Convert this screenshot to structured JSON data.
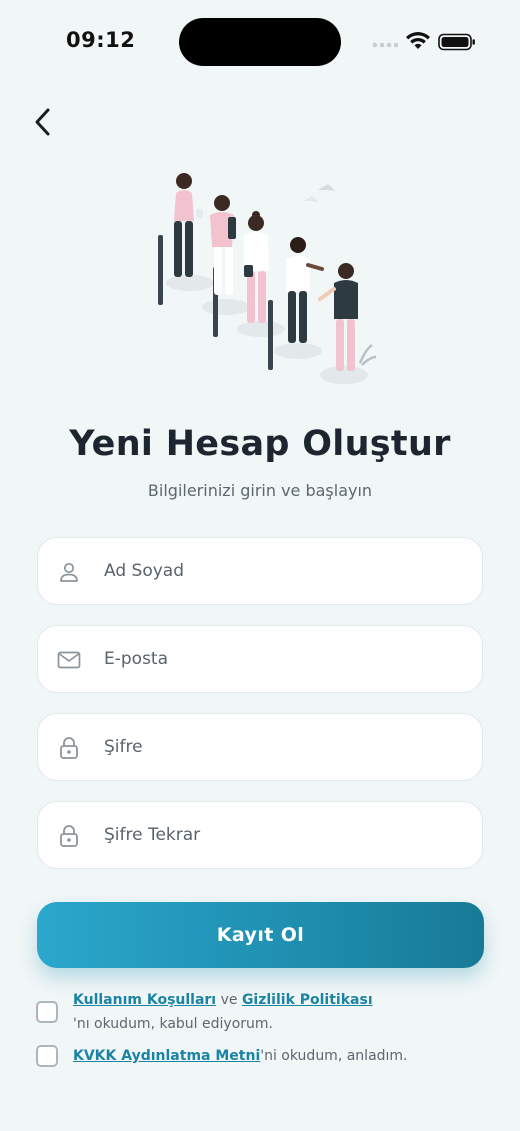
{
  "status_bar": {
    "time": "09:12"
  },
  "header": {
    "back_icon": "chevron-left-icon"
  },
  "hero": {
    "title": "Yeni Hesap Oluştur",
    "subtitle": "Bilgilerinizi girin ve başlayın"
  },
  "form": {
    "fields": [
      {
        "icon": "user-icon",
        "placeholder": "Ad Soyad",
        "value": ""
      },
      {
        "icon": "mail-icon",
        "placeholder": "E-posta",
        "value": ""
      },
      {
        "icon": "lock-icon",
        "placeholder": "Şifre",
        "value": ""
      },
      {
        "icon": "lock-icon",
        "placeholder": "Şifre Tekrar",
        "value": ""
      }
    ],
    "submit_label": "Kayıt Ol"
  },
  "consents": {
    "terms": {
      "link1": "Kullanım Koşulları",
      "connector": " ve ",
      "link2": "Gizlilik Politikası",
      "suffix": "'nı okudum, kabul ediyorum."
    },
    "kvkk": {
      "link": "KVKK Aydınlatma Metni",
      "suffix": "'ni okudum, anladım."
    }
  },
  "colors": {
    "background": "#f1f6f7",
    "accent": "#1f90b1",
    "link": "#1b84a4",
    "title": "#1d2630"
  }
}
